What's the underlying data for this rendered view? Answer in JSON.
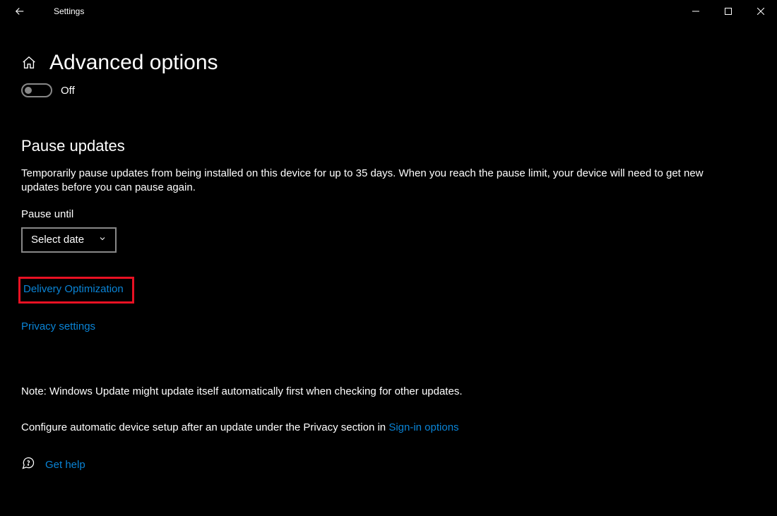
{
  "window": {
    "title": "Settings"
  },
  "page": {
    "title": "Advanced options"
  },
  "toggle": {
    "state": "Off"
  },
  "pause": {
    "heading": "Pause updates",
    "description": "Temporarily pause updates from being installed on this device for up to 35 days. When you reach the pause limit, your device will need to get new updates before you can pause again.",
    "label": "Pause until",
    "select": "Select date"
  },
  "links": {
    "delivery": "Delivery Optimization",
    "privacy": "Privacy settings"
  },
  "notes": {
    "autoupdate": "Note: Windows Update might update itself automatically first when checking for other updates.",
    "signin_pre": "Configure automatic device setup after an update under the Privacy section in ",
    "signin_link": "Sign-in options"
  },
  "help": {
    "label": "Get help"
  }
}
